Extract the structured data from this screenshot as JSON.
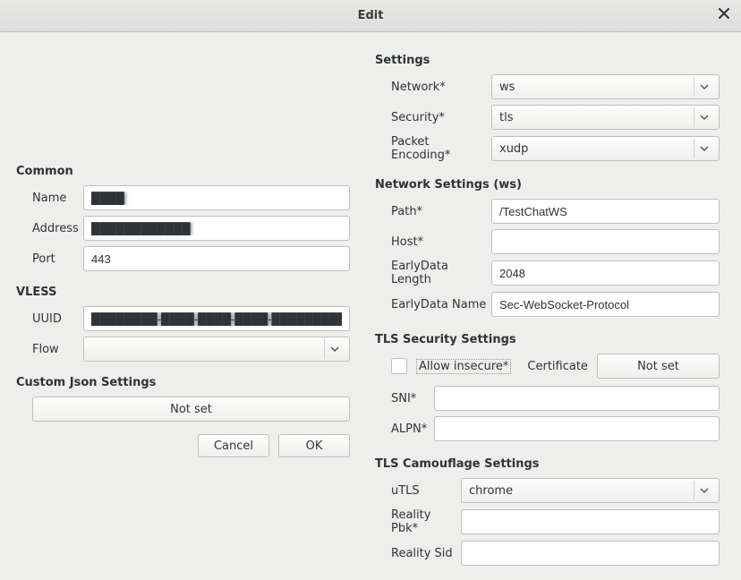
{
  "window": {
    "title": "Edit"
  },
  "common": {
    "heading": "Common",
    "name_label": "Name",
    "name_value": "████",
    "address_label": "Address",
    "address_value": "████████████",
    "port_label": "Port",
    "port_value": "443"
  },
  "vless": {
    "heading": "VLESS",
    "uuid_label": "UUID",
    "uuid_value": "████████-████-████-████-████████████",
    "flow_label": "Flow",
    "flow_value": ""
  },
  "custom_json": {
    "heading": "Custom Json Settings",
    "button_label": "Not set"
  },
  "buttons": {
    "cancel": "Cancel",
    "ok": "OK"
  },
  "settings": {
    "heading": "Settings",
    "network_label": "Network*",
    "network_value": "ws",
    "security_label": "Security*",
    "security_value": "tls",
    "packet_enc_label": "Packet Encoding*",
    "packet_enc_value": "xudp"
  },
  "network_settings": {
    "heading": "Network Settings (ws)",
    "path_label": "Path*",
    "path_value": "/TestChatWS",
    "host_label": "Host*",
    "host_value": "",
    "earlydata_len_label": "EarlyData Length",
    "earlydata_len_value": "2048",
    "earlydata_name_label": "EarlyData Name",
    "earlydata_name_value": "Sec-WebSocket-Protocol"
  },
  "tls_security": {
    "heading": "TLS Security Settings",
    "allow_insecure_label": "Allow insecure*",
    "certificate_label": "Certificate",
    "certificate_value": "Not set",
    "sni_label": "SNI*",
    "sni_value": "",
    "alpn_label": "ALPN*",
    "alpn_value": ""
  },
  "tls_camo": {
    "heading": "TLS Camouflage Settings",
    "utls_label": "uTLS",
    "utls_value": "chrome",
    "pbk_label": "Reality Pbk*",
    "pbk_value": "",
    "sid_label": "Reality Sid",
    "sid_value": ""
  }
}
